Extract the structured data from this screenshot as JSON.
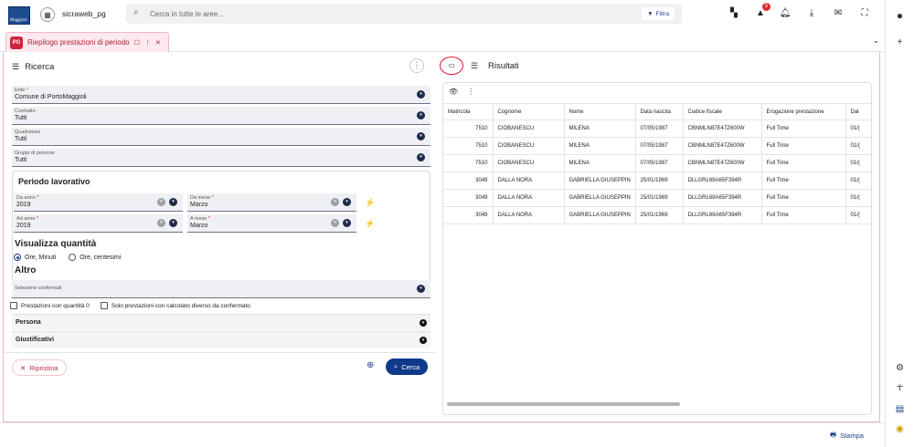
{
  "header": {
    "logo_text": "Maggiori",
    "app_name": "sicraweb_pg",
    "search_placeholder": "Cerca in tutte le aree...",
    "filter_label": "Filtra",
    "alert_count": "5"
  },
  "tab": {
    "logo": "PG",
    "title": "Riepilogo prestazioni di periodo"
  },
  "left": {
    "title": "Ricerca",
    "fields": [
      {
        "label": "Ente",
        "required": true,
        "value": "Comune di PortoMaggioli"
      },
      {
        "label": "Contratto",
        "required": false,
        "value": "Tutti"
      },
      {
        "label": "Quadratura",
        "required": false,
        "value": "Tutti"
      },
      {
        "label": "Gruppi di persone",
        "required": false,
        "value": "Tutti"
      }
    ],
    "period": {
      "title": "Periodo lavorativo",
      "da_anno": {
        "label": "Da anno",
        "value": "2019"
      },
      "da_mese": {
        "label": "Da mese",
        "value": "Marzo"
      },
      "ad_anno": {
        "label": "Ad anno",
        "value": "2019"
      },
      "a_mese": {
        "label": "A mese",
        "value": "Marzo"
      }
    },
    "visualizza": {
      "title": "Visualizza quantità",
      "option1": "Ore, Minuti",
      "option2": "Ore, centesimi",
      "selected": "Ore, Minuti"
    },
    "altro": {
      "title": "Altro",
      "selezione_label": "Selezione confermati",
      "check1": "Prestazioni con quantità 0",
      "check2": "Solo prestazioni con calcolato diverso da confermato"
    },
    "accordions": [
      "Persona",
      "Giustificativi"
    ],
    "reset_label": "Ripristina",
    "search_label": "Cerca"
  },
  "right": {
    "title": "Risultati",
    "columns": [
      "Matricola",
      "Cognome",
      "Nome",
      "Data nascita",
      "Codice fiscale",
      "Erogazione prestazione",
      "Dal"
    ],
    "rows": [
      [
        "7510",
        "CIOBANESCU",
        "MILENA",
        "07/05/1987",
        "CBNMLN87E47Z600W",
        "Full Time",
        "01/("
      ],
      [
        "7510",
        "CIOBANESCU",
        "MILENA",
        "07/05/1987",
        "CBNMLN87E47Z600W",
        "Full Time",
        "01/("
      ],
      [
        "7510",
        "CIOBANESCU",
        "MILENA",
        "07/05/1987",
        "CBNMLN87E47Z600W",
        "Full Time",
        "01/("
      ],
      [
        "3049",
        "DALLA NORA",
        "GABRIELLA GIUSEPPIN",
        "25/01/1969",
        "DLLGRL69A65F394R",
        "Full Time",
        "01/("
      ],
      [
        "3049",
        "DALLA NORA",
        "GABRIELLA GIUSEPPIN",
        "25/01/1969",
        "DLLGRL69A65F394R",
        "Full Time",
        "01/("
      ],
      [
        "3049",
        "DALLA NORA",
        "GABRIELLA GIUSEPPIN",
        "25/01/1969",
        "DLLGRL69A65F394R",
        "Full Time",
        "01/("
      ]
    ]
  },
  "footer": {
    "print_label": "Stampa"
  },
  "colors": {
    "accent": "#0f3a8a",
    "tab": "#c8263f",
    "highlight_ring": "#e0112b"
  }
}
